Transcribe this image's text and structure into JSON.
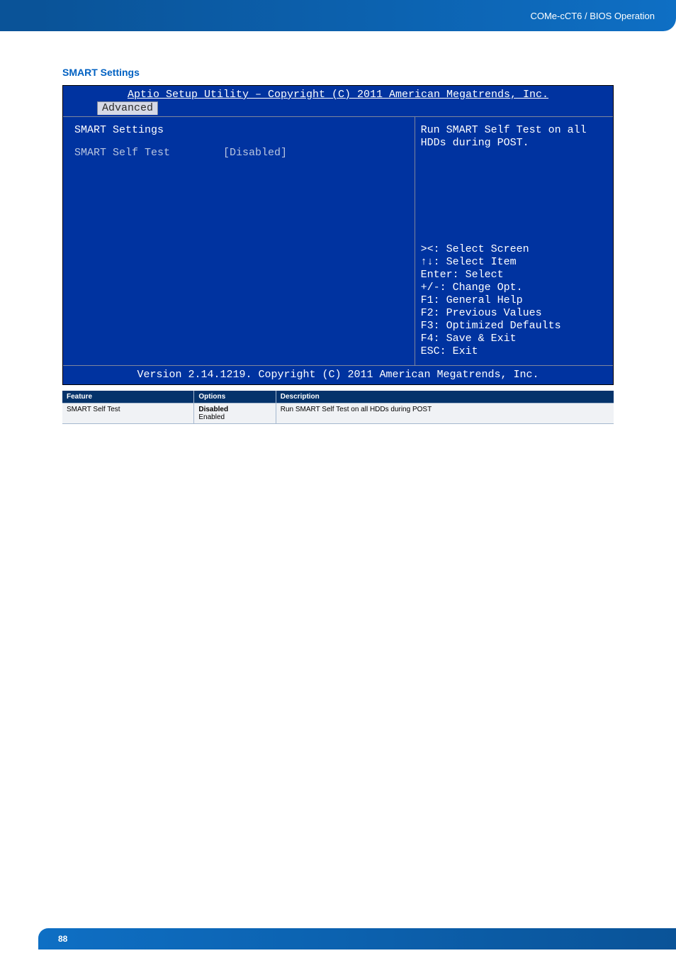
{
  "header": {
    "breadcrumb": "COMe-cCT6 / BIOS Operation"
  },
  "section": {
    "title": "SMART Settings"
  },
  "bios": {
    "title": "Aptio Setup Utility – Copyright (C) 2011 American Megatrends, Inc.",
    "tab": "Advanced",
    "heading": "SMART Settings",
    "option_label": "SMART Self Test",
    "option_value": "[Disabled]",
    "help_top": "Run SMART Self Test on all HDDs during POST.",
    "keys": {
      "k1": "><: Select Screen",
      "k2": "↑↓: Select Item",
      "k3": "Enter: Select",
      "k4": "+/-: Change Opt.",
      "k5": "F1: General Help",
      "k6": "F2: Previous Values",
      "k7": "F3: Optimized Defaults",
      "k8": "F4: Save & Exit",
      "k9": "ESC: Exit"
    },
    "footer": "Version 2.14.1219. Copyright (C) 2011 American Megatrends, Inc."
  },
  "table": {
    "h1": "Feature",
    "h2": "Options",
    "h3": "Description",
    "r1c1": "SMART Self Test",
    "r1c2a": "Disabled",
    "r1c2b": "Enabled",
    "r1c3": "Run SMART Self Test on all HDDs during POST"
  },
  "page": {
    "number": "88"
  }
}
